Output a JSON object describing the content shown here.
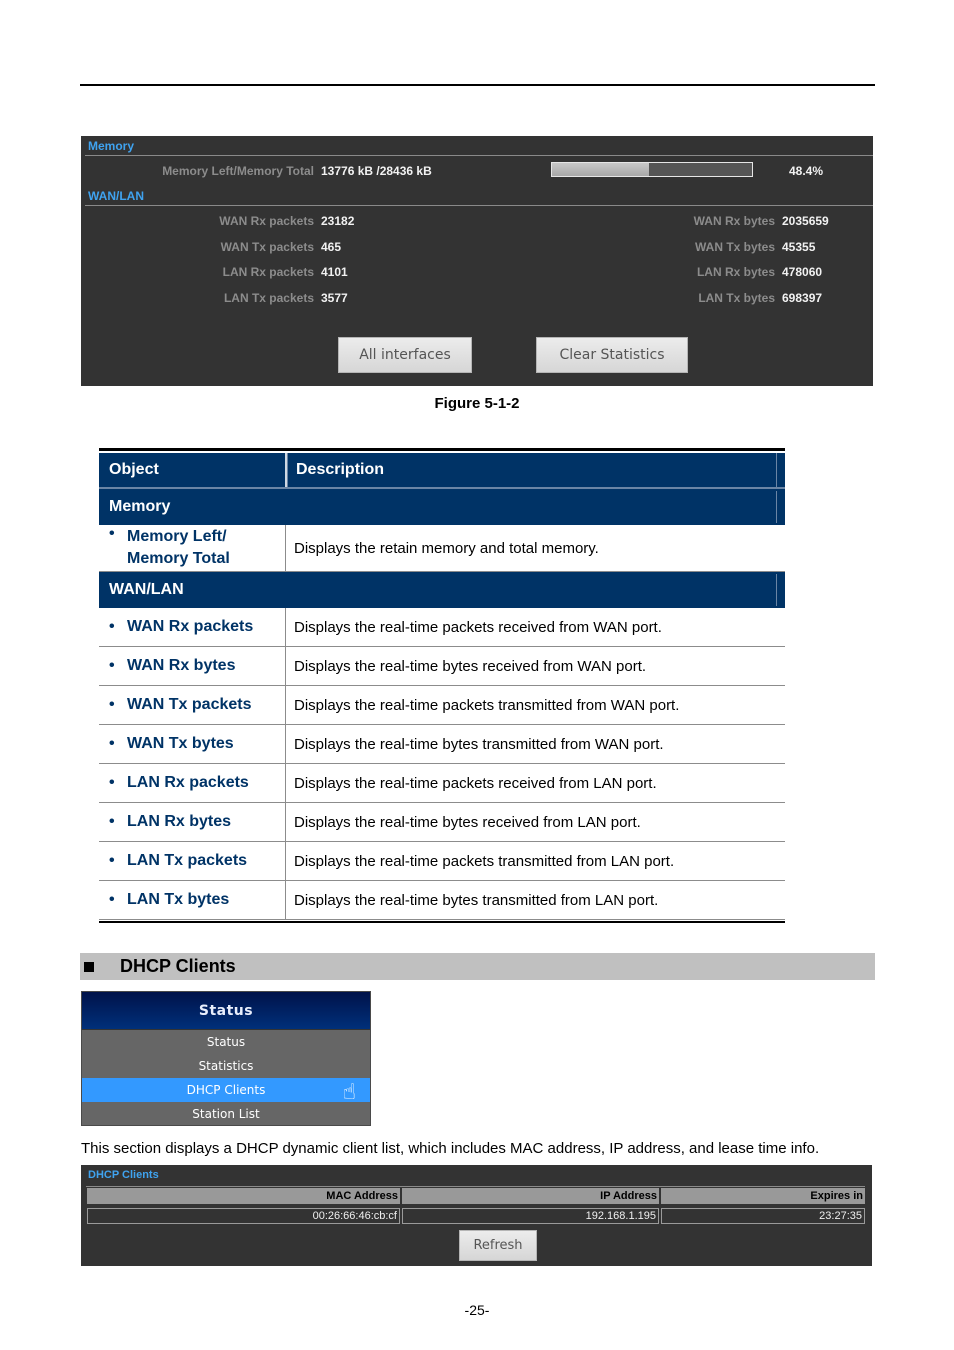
{
  "stats_panel": {
    "memory_title": "Memory",
    "memory_label": "Memory Left/Memory Total",
    "memory_value": "13776 kB /28436 kB",
    "memory_percent_text": "48.4%",
    "memory_percent": 48.4,
    "wanlan_title": "WAN/LAN",
    "left": [
      {
        "label": "WAN Rx packets",
        "value": "23182"
      },
      {
        "label": "WAN Tx packets",
        "value": "465"
      },
      {
        "label": "LAN Rx packets",
        "value": "4101"
      },
      {
        "label": "LAN Tx packets",
        "value": "3577"
      }
    ],
    "right": [
      {
        "label": "WAN Rx bytes",
        "value": "2035659"
      },
      {
        "label": "WAN Tx bytes",
        "value": "45355"
      },
      {
        "label": "LAN Rx bytes",
        "value": "478060"
      },
      {
        "label": "LAN Tx bytes",
        "value": "698397"
      }
    ],
    "buttons": {
      "all_interfaces": "All interfaces",
      "clear_statistics": "Clear Statistics"
    }
  },
  "figure_caption": "Figure 5-1-2",
  "desc_table": {
    "headers": {
      "object": "Object",
      "description": "Description"
    },
    "memory_section": "Memory",
    "memory_row": {
      "object_line1": "Memory Left/",
      "object_line2": "Memory Total",
      "description": "Displays the retain memory and total memory."
    },
    "wanlan_section": "WAN/LAN",
    "rows": [
      {
        "object": "WAN Rx packets",
        "description": "Displays the real-time packets received from WAN port."
      },
      {
        "object": "WAN Rx bytes",
        "description": "Displays the real-time bytes received from WAN port."
      },
      {
        "object": "WAN Tx packets",
        "description": "Displays the real-time packets transmitted from WAN port."
      },
      {
        "object": "WAN Tx bytes",
        "description": "Displays the real-time bytes transmitted from WAN port."
      },
      {
        "object": "LAN Rx packets",
        "description": "Displays the real-time packets received from LAN port."
      },
      {
        "object": "LAN Rx bytes",
        "description": "Displays the real-time bytes received from LAN port."
      },
      {
        "object": "LAN Tx packets",
        "description": "Displays the real-time packets transmitted from LAN port."
      },
      {
        "object": "LAN Tx bytes",
        "description": "Displays the real-time bytes transmitted from LAN port."
      }
    ],
    "bullet": "•"
  },
  "section_heading": "DHCP Clients",
  "status_menu": {
    "title": "Status",
    "items": [
      "Status",
      "Statistics",
      "DHCP Clients",
      "Station List"
    ],
    "active_index": 2,
    "cursor_icon": "☝"
  },
  "body_text": "This section displays a DHCP dynamic client list, which includes MAC address, IP address, and lease time info.",
  "dhcp_panel": {
    "title": "DHCP Clients",
    "columns": [
      "MAC Address",
      "IP Address",
      "Expires in"
    ],
    "rows": [
      [
        "00:26:66:46:cb:cf",
        "192.168.1.195",
        "23:27:35"
      ]
    ],
    "refresh_label": "Refresh"
  },
  "page_number": "-25-"
}
